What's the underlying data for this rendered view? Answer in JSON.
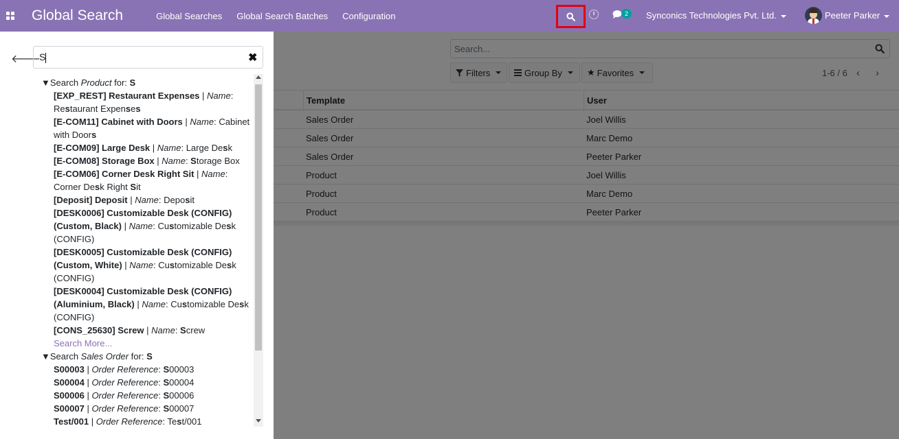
{
  "navbar": {
    "title": "Global Search",
    "menu": [
      "Global Searches",
      "Global Search Batches",
      "Configuration"
    ],
    "chat_badge": "2",
    "company": "Synconics Technologies Pvt. Ltd.",
    "user": "Peeter Parker",
    "icons": [
      "apps-grid-icon",
      "search-icon",
      "clock-icon",
      "chat-icon"
    ],
    "highlight_color": "#e3000f",
    "bar_color": "#8a73b4"
  },
  "main": {
    "search_placeholder": "Search...",
    "filters_label": "Filters",
    "groupby_label": "Group By",
    "favorites_label": "Favorites",
    "pager": "1-6 / 6",
    "columns": [
      "Template",
      "User"
    ],
    "rows": [
      {
        "template": "Sales Order",
        "user": "Joel Willis"
      },
      {
        "template": "Sales Order",
        "user": "Marc Demo"
      },
      {
        "template": "Sales Order",
        "user": "Peeter Parker"
      },
      {
        "template": "Product",
        "user": "Joel Willis"
      },
      {
        "template": "Product",
        "user": "Marc Demo"
      },
      {
        "template": "Product",
        "user": "Peeter Parker"
      }
    ]
  },
  "panel": {
    "query": "S",
    "groups": [
      {
        "prefix": "Search ",
        "model": "Product",
        "suffix": " for: ",
        "term": "S",
        "items": [
          {
            "code": "[EXP_REST] Restaurant Expenses",
            "field": "Name",
            "value": "Restaurant Expenses"
          },
          {
            "code": "[E-COM11] Cabinet with Doors",
            "field": "Name",
            "value": "Cabinet with Doors"
          },
          {
            "code": "[E-COM09] Large Desk",
            "field": "Name",
            "value": "Large Desk"
          },
          {
            "code": "[E-COM08] Storage Box",
            "field": "Name",
            "value": "Storage Box"
          },
          {
            "code": "[E-COM06] Corner Desk Right Sit",
            "field": "Name",
            "value": "Corner Desk Right Sit"
          },
          {
            "code": "[Deposit] Deposit",
            "field": "Name",
            "value": "Deposit"
          },
          {
            "code": "[DESK0006] Customizable Desk (CONFIG) (Custom, Black)",
            "field": "Name",
            "value": "Customizable Desk (CONFIG)"
          },
          {
            "code": "[DESK0005] Customizable Desk (CONFIG) (Custom, White)",
            "field": "Name",
            "value": "Customizable Desk (CONFIG)"
          },
          {
            "code": "[DESK0004] Customizable Desk (CONFIG) (Aluminium, Black)",
            "field": "Name",
            "value": "Customizable Desk (CONFIG)"
          },
          {
            "code": "[CONS_25630] Screw",
            "field": "Name",
            "value": "Screw"
          }
        ],
        "more": "Search More..."
      },
      {
        "prefix": "Search ",
        "model": "Sales Order",
        "suffix": " for: ",
        "term": "S",
        "items": [
          {
            "code": "S00003",
            "field": "Order Reference",
            "value": "S00003"
          },
          {
            "code": "S00004",
            "field": "Order Reference",
            "value": "S00004"
          },
          {
            "code": "S00006",
            "field": "Order Reference",
            "value": "S00006"
          },
          {
            "code": "S00007",
            "field": "Order Reference",
            "value": "S00007"
          },
          {
            "code": "Test/001",
            "field": "Order Reference",
            "value": "Test/001"
          }
        ]
      }
    ]
  }
}
